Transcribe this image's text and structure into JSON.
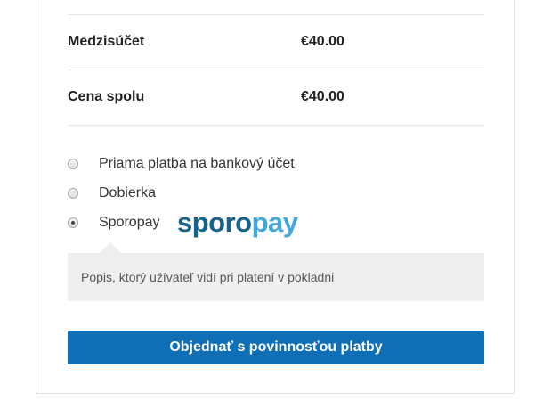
{
  "totals": {
    "subtotal": {
      "label": "Medzisúčet",
      "value": "€40.00"
    },
    "total": {
      "label": "Cena spolu",
      "value": "€40.00"
    }
  },
  "payment_methods": [
    {
      "label": "Priama platba na bankový účet",
      "selected": false
    },
    {
      "label": "Dobierka",
      "selected": false
    },
    {
      "label": "Sporopay",
      "selected": true,
      "logo_text_left": "sporo",
      "logo_text_right": "pay"
    }
  ],
  "payment_description": "Popis, ktorý užívateľ vidí pri platení v pokladni",
  "order_button_label": "Objednať s povinnosťou platby",
  "colors": {
    "button_background": "#0e6fb7",
    "button_text": "#ffffff",
    "description_background": "#efefef",
    "logo_dark": "#16628f",
    "logo_light": "#3fa7dc"
  }
}
